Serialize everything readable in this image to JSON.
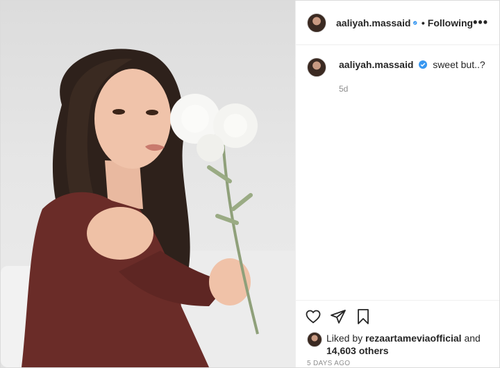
{
  "header": {
    "username": "aaliyah.massaid",
    "separator": "•",
    "follow_status": "Following",
    "more_icon": "more-options-icon",
    "more_label": "•••"
  },
  "caption": {
    "username": "aaliyah.massaid",
    "text": "sweet but..?",
    "age": "5d"
  },
  "actions": {
    "like_icon": "heart-icon",
    "share_icon": "paper-plane-icon",
    "save_icon": "bookmark-icon"
  },
  "likes": {
    "prefix": "Liked by",
    "user": "rezaartameviaofficial",
    "and": "and",
    "count": "14,603 others"
  },
  "timestamp": "5 DAYS AGO",
  "colors": {
    "verified_blue": "#3897f0",
    "sweater": "#6a2c28",
    "hair": "#2e211b",
    "background": "#e4e4e4"
  }
}
